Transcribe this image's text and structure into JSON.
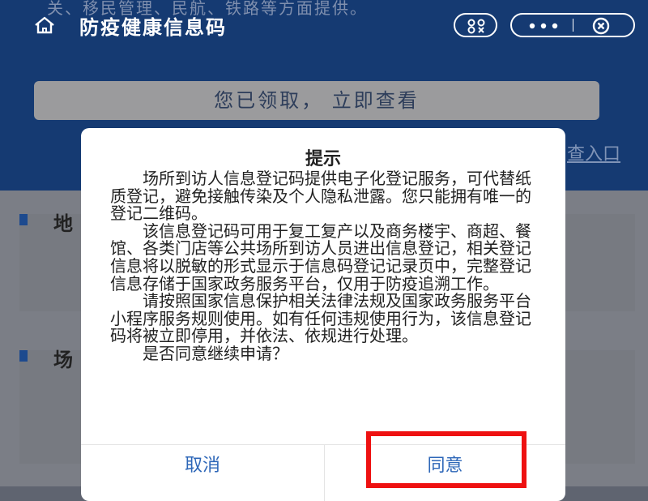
{
  "background": {
    "faded_top_text": "关、移民管理、民航、铁路等方面提供。",
    "banner_button": "您已领取， 立即查看",
    "entry_link": "查入口",
    "section_1_title": "地",
    "section_2_title": "场"
  },
  "titlebar": {
    "title": "防疫健康信息码"
  },
  "dialog": {
    "title": "提示",
    "paragraphs": [
      "场所到访人信息登记码提供电子化登记服务，可代替纸质登记，避免接触传染及个人隐私泄露。您只能拥有唯一的登记二维码。",
      "该信息登记码可用于复工复产以及商务楼宇、商超、餐馆、各类门店等公共场所到访人员进出信息登记，相关登记信息将以脱敏的形式显示于信息码登记记录页中，完整登记信息存储于国家政务服务平台，仅用于防疫追溯工作。",
      "请按照国家信息保护相关法律法规及国家政务服务平台小程序服务规则使用。如有任何违规使用行为，该信息登记码将被立即停用，并依法、依规进行处理。",
      "是否同意继续申请？"
    ],
    "cancel_label": "取消",
    "agree_label": "同意"
  },
  "colors": {
    "header_bg": "#153a72",
    "accent_blue": "#2e67b8",
    "highlight_red": "#ee1111"
  },
  "icons": {
    "home": "home-icon",
    "scan": "scan-icon",
    "more": "more-dots-icon",
    "close": "close-circle-icon"
  }
}
